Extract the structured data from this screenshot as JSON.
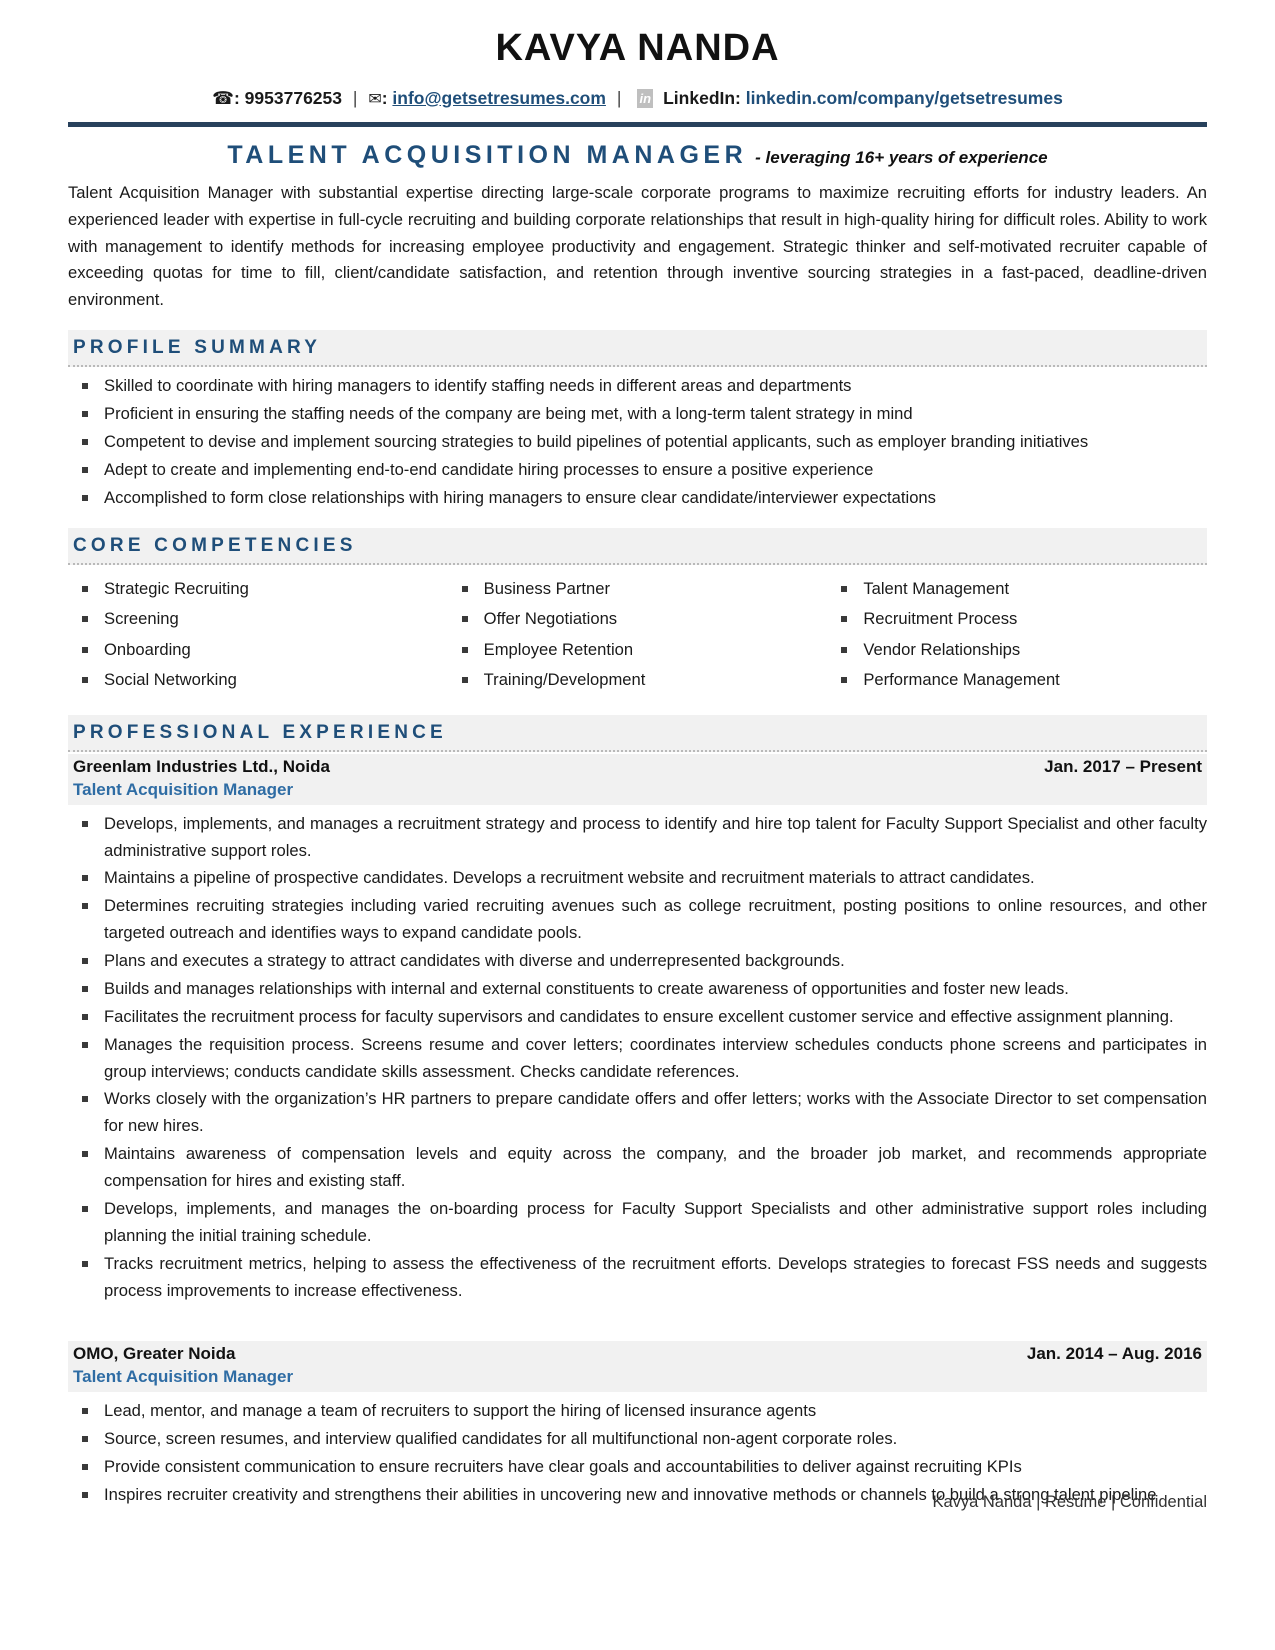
{
  "header": {
    "name": "KAVYA NANDA",
    "phone_icon": "phone-icon",
    "phone": ": 9953776253",
    "mail_icon": "✉",
    "mail_colon": ":",
    "email": "info@getsetresumes.com",
    "linkedin_badge": "in",
    "linkedin_label": "LinkedIn:",
    "linkedin_url": "linkedin.com/company/getsetresumes",
    "separator": "|"
  },
  "title": {
    "main": "TALENT ACQUISITION MANAGER",
    "sub": "- leveraging 16+ years of experience"
  },
  "summary": {
    "paragraph": "Talent Acquisition Manager with substantial expertise directing large-scale corporate programs to maximize recruiting efforts for industry leaders. An experienced leader with expertise in full-cycle recruiting and building corporate relationships that result in high-quality hiring for difficult roles. Ability to work with management to identify methods for increasing employee productivity and engagement. Strategic thinker and self-motivated recruiter capable of exceeding quotas for time to fill, client/candidate satisfaction, and retention through inventive sourcing strategies in a fast-paced, deadline-driven environment."
  },
  "profile_summary": {
    "heading": "PROFILE SUMMARY",
    "items": [
      "Skilled to coordinate with hiring managers to identify staffing needs in different areas and departments",
      "Proficient in ensuring the staffing needs of the company are being met, with a long-term talent strategy in mind",
      "Competent to devise and implement sourcing strategies to build pipelines of potential applicants, such as employer branding initiatives",
      "Adept to create and implementing end-to-end candidate hiring processes to ensure a positive experience",
      "Accomplished to form close relationships with hiring managers to ensure clear candidate/interviewer expectations"
    ]
  },
  "core_competencies": {
    "heading": "CORE COMPETENCIES",
    "column1": [
      "Strategic Recruiting",
      "Screening",
      "Onboarding",
      "Social Networking"
    ],
    "column2": [
      "Business Partner",
      "Offer Negotiations",
      "Employee Retention",
      "Training/Development"
    ],
    "column3": [
      "Talent Management",
      "Recruitment Process",
      "Vendor Relationships",
      "Performance Management"
    ]
  },
  "professional_experience": {
    "heading": "PROFESSIONAL EXPERIENCE",
    "jobs": [
      {
        "company": "Greenlam Industries Ltd., Noida",
        "dates": "Jan. 2017 – Present",
        "role": "Talent Acquisition Manager",
        "bullets": [
          "Develops, implements, and manages a recruitment strategy and process to identify and hire top talent for Faculty Support Specialist and other faculty administrative support roles.",
          "Maintains a pipeline of prospective candidates. Develops a recruitment website and recruitment materials to attract candidates.",
          "Determines recruiting strategies including varied recruiting avenues such as college recruitment, posting positions to online resources, and other targeted outreach and identifies ways to expand candidate pools.",
          "Plans and executes a strategy to attract candidates with diverse and underrepresented backgrounds.",
          "Builds and manages relationships with internal and external constituents to create awareness of opportunities and foster new leads.",
          "Facilitates the recruitment process for faculty supervisors and candidates to ensure excellent customer service and effective assignment planning.",
          "Manages the requisition process. Screens resume and cover letters; coordinates interview schedules conducts phone screens and participates in group interviews; conducts candidate skills assessment. Checks candidate references.",
          "Works closely with the organization’s HR partners to prepare candidate offers and offer letters; works with the Associate Director to set compensation for new hires.",
          "Maintains awareness of compensation levels and equity across the company, and the broader job market, and recommends appropriate compensation for hires and existing staff.",
          "Develops, implements, and manages the on-boarding process for Faculty Support Specialists and other administrative support roles including planning the initial training schedule.",
          "Tracks recruitment metrics, helping to assess the effectiveness of the recruitment efforts. Develops strategies to forecast FSS needs and suggests process improvements to increase effectiveness."
        ]
      },
      {
        "company": "OMO, Greater Noida",
        "dates": "Jan. 2014 – Aug. 2016",
        "role": "Talent Acquisition Manager",
        "bullets": [
          "Lead, mentor, and manage a team of recruiters to support the hiring of licensed insurance agents",
          "Source, screen resumes, and interview qualified candidates for all multifunctional non-agent corporate roles.",
          "Provide consistent communication to ensure recruiters have clear goals and accountabilities to deliver against recruiting KPIs",
          "Inspires recruiter creativity and strengthens their abilities in uncovering new and innovative methods or channels to build a strong talent pipeline"
        ]
      }
    ]
  },
  "footer": {
    "text": "Kavya Nanda | Resume | Confidential"
  },
  "colors": {
    "accent_blue": "#1f4e79",
    "role_blue": "#2e6ca4",
    "rule_navy": "#28415c",
    "section_bg": "#f1f1f1",
    "badge_gray": "#bfbfbf"
  }
}
